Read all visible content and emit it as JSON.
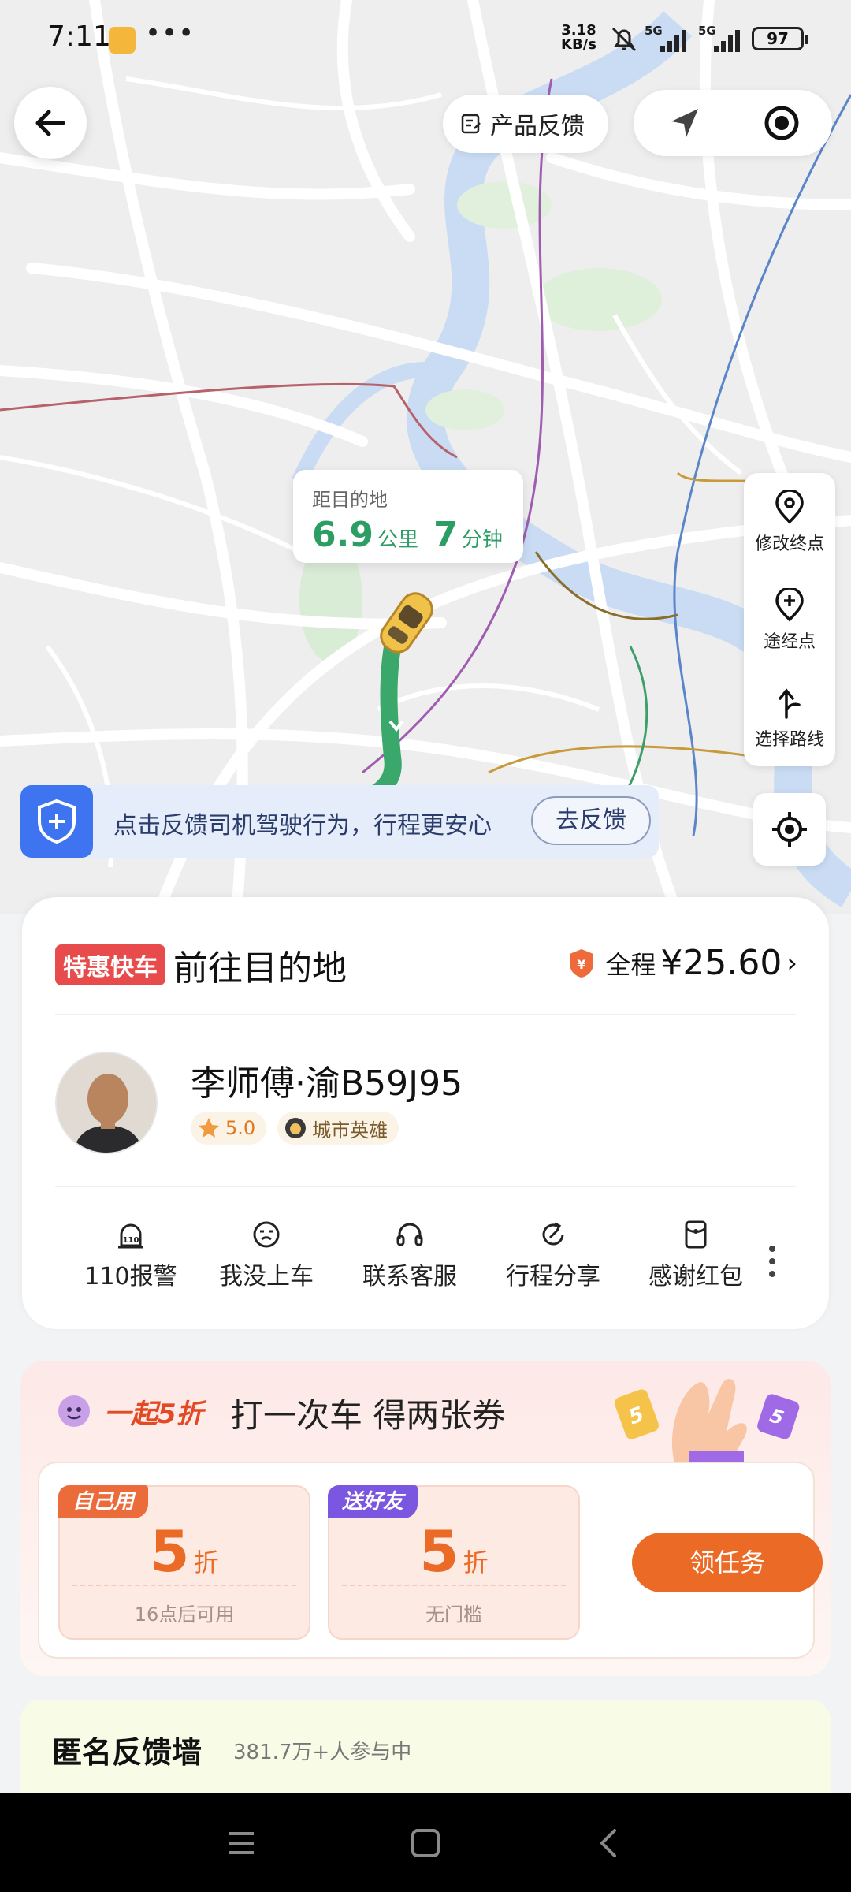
{
  "status_bar": {
    "time": "7:11",
    "net_speed_value": "3.18",
    "net_speed_unit": "KB/s",
    "signal_1": "5G",
    "signal_2": "5G",
    "battery": "97"
  },
  "top": {
    "feedback_label": "产品反馈"
  },
  "map": {
    "distance_label": "距目的地",
    "distance_value": "6.9",
    "distance_unit": "公里",
    "time_value": "7",
    "time_unit": "分钟"
  },
  "tools": [
    {
      "label": "修改终点",
      "icon": "pin-icon"
    },
    {
      "label": "途经点",
      "icon": "plus-pin-icon"
    },
    {
      "label": "选择路线",
      "icon": "route-fork-icon"
    }
  ],
  "banner": {
    "text": "点击反馈司机驾驶行为，行程更安心",
    "button": "去反馈"
  },
  "trip": {
    "service_badge": "特惠快车",
    "status": "前往目的地",
    "fare_label": "全程",
    "fare_amount": "¥25.60",
    "driver": "李师傅·渝B59J95",
    "rating": "5.0",
    "honor": "城市英雄",
    "actions": [
      {
        "label": "110报警",
        "icon": "alarm-110-icon"
      },
      {
        "label": "我没上车",
        "icon": "face-icon"
      },
      {
        "label": "联系客服",
        "icon": "headset-icon"
      },
      {
        "label": "行程分享",
        "icon": "share-icon"
      },
      {
        "label": "感谢红包",
        "icon": "red-packet-icon"
      }
    ]
  },
  "promo": {
    "tag": "一起5折",
    "headline": "打一次车 得两张券",
    "coupons": [
      {
        "ribbon": "自己用",
        "value": "5",
        "unit": "折",
        "condition": "16点后可用",
        "color": "#ec6b3b"
      },
      {
        "ribbon": "送好友",
        "value": "5",
        "unit": "折",
        "condition": "无门槛",
        "color": "#7b56e0"
      }
    ],
    "button": "领任务"
  },
  "wall": {
    "title": "匿名反馈墙",
    "subtitle": "381.7万+人参与中"
  },
  "colors": {
    "route": "#2c9e64",
    "accent_orange": "#ea6a26",
    "badge_red": "#e74b4b",
    "safety_blue": "#3e74f0"
  }
}
